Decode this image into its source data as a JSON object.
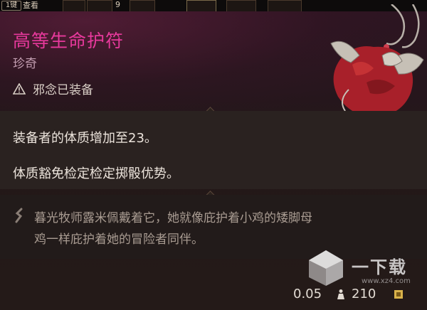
{
  "hotbar": {
    "hotkey": "1键",
    "label": "查看",
    "count": "9"
  },
  "item": {
    "name": "高等生命护符",
    "rarity": "珍奇",
    "status": "邪念已装备",
    "effects": [
      "装备者的体质增加至23。",
      "体质豁免检定检定掷骰优势。"
    ],
    "lore_line1": "暮光牧师露米佩戴着它，她就像庇护着小鸡的矮脚母",
    "lore_line2": "鸡一样庇护着她的冒险者同伴。",
    "weight": "0.05",
    "price": "210"
  },
  "watermark": {
    "text": "一下载",
    "url": "www.xz4.com"
  },
  "icons": {
    "warning": "warning-triangle-icon",
    "quote": "quote-icon",
    "weight": "weight-icon",
    "coin": "coin-icon"
  },
  "colors": {
    "title": "#e7399c",
    "rarity": "#c49fb2",
    "effect_text": "#ece4dc",
    "lore_text": "#a99c92"
  }
}
